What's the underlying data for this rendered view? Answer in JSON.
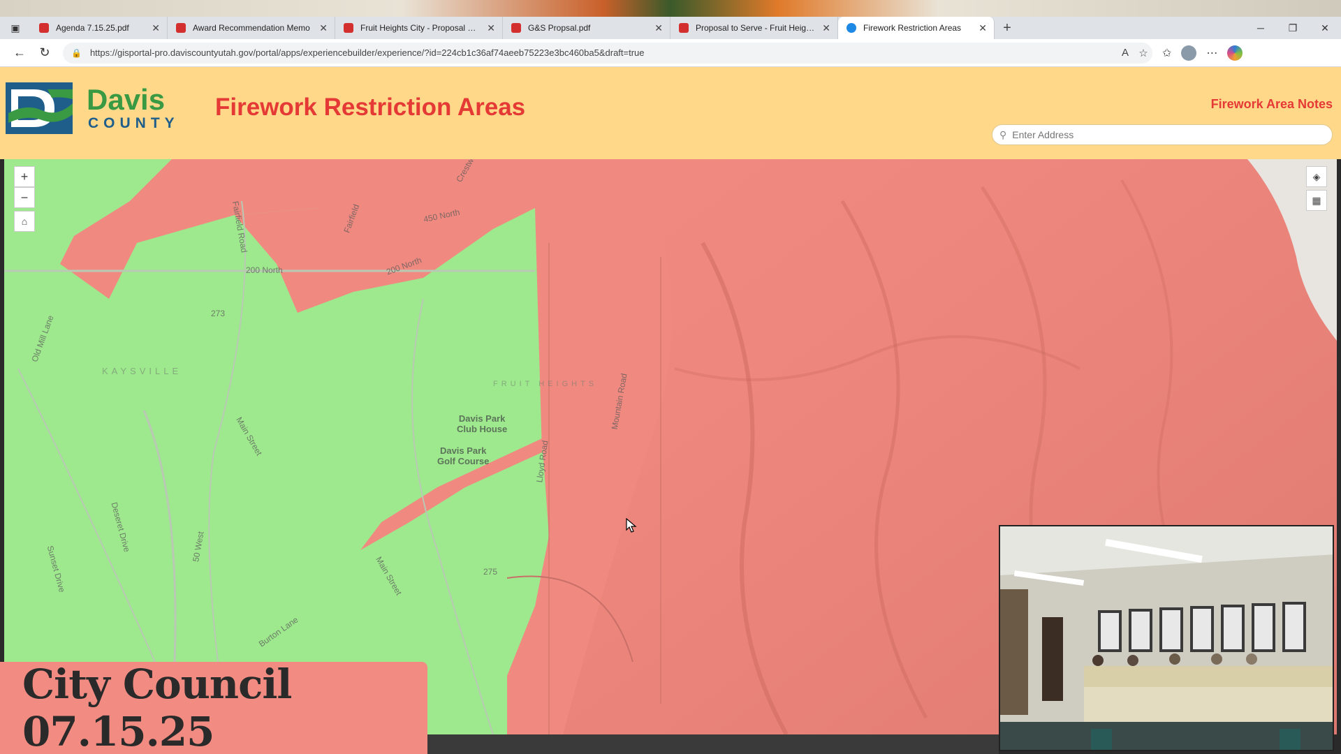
{
  "browser": {
    "tabs": [
      {
        "label": "Agenda 7.15.25.pdf",
        "active": false
      },
      {
        "label": "Award Recommendation Memo",
        "active": false
      },
      {
        "label": "Fruit Heights City - Proposal date",
        "active": false
      },
      {
        "label": "G&S Propsal.pdf",
        "active": false
      },
      {
        "label": "Proposal to Serve - Fruit Heights",
        "active": false
      },
      {
        "label": "Firework Restriction Areas",
        "active": true
      }
    ],
    "tab_close_glyph": "✕",
    "new_tab_glyph": "+",
    "url": "https://gisportal-pro.daviscountyutah.gov/portal/apps/experiencebuilder/experience/?id=224cb1c36af74aeeb75223e3bc460ba5&draft=true"
  },
  "app": {
    "brand_top": "Davis",
    "brand_bottom": "COUNTY",
    "title": "Firework Restriction Areas",
    "notes_link": "Firework Area Notes",
    "search_placeholder": "Enter Address"
  },
  "map": {
    "zoom_in": "+",
    "zoom_out": "−",
    "colors": {
      "restricted": "#f08a80",
      "unrestricted": "#9ee88e"
    },
    "labels": {
      "street_200n_a": "200 North",
      "street_200n_b": "200 North",
      "street_450n": "450 North",
      "fairfield": "Fairfield Road",
      "mountain": "Mountain Road",
      "main_street": "Main Street",
      "old_mill": "Old Mill Lane",
      "davis_park_club": "Davis Park\nClub House",
      "davis_park_golf": "Davis Park\nGolf Course",
      "kaysville": "KAYSVILLE",
      "fruit_heights": "FRUIT HEIGHTS",
      "burton": "Burton Lane",
      "deseret": "Deseret Drive",
      "sunset": "Sunset Drive",
      "west_50": "50 West",
      "hwy_273": "273",
      "hwy_275": "275",
      "lloyd": "Lloyd Road",
      "canyon": "Crestwood",
      "fairfield_b": "Fairfield"
    }
  },
  "overlay": {
    "caption": "City Council 07.15.25"
  }
}
